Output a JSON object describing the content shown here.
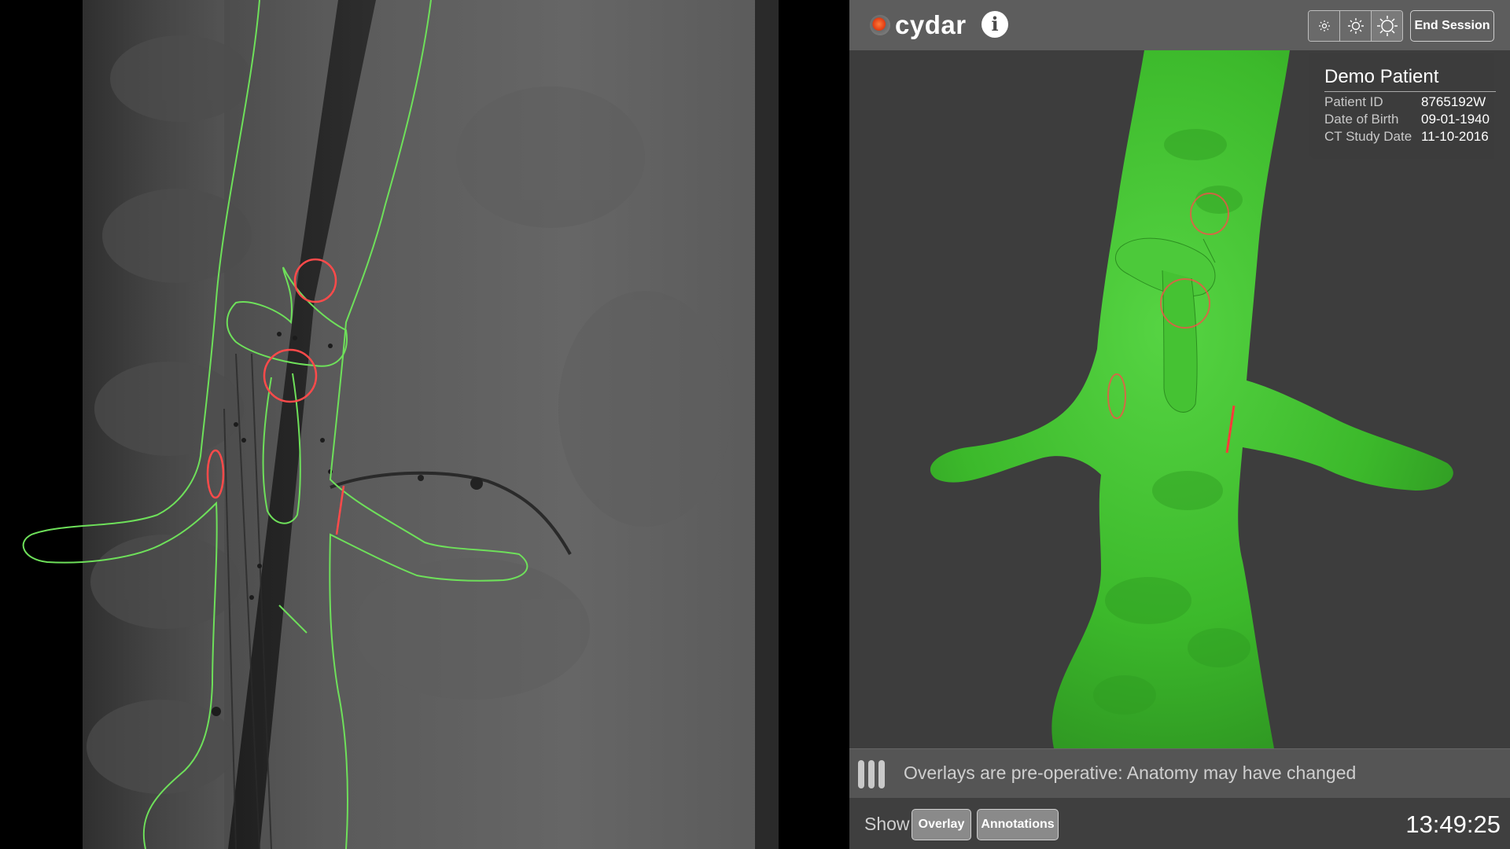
{
  "app": {
    "logo_text": "cydar",
    "info_label": "i",
    "brightness_icons": [
      "sun-small-icon",
      "sun-medium-icon",
      "sun-large-icon"
    ],
    "end_session_label": "End Session"
  },
  "patient": {
    "name": "Demo Patient",
    "fields": [
      {
        "label": "Patient ID",
        "value": "8765192W"
      },
      {
        "label": "Date of Birth",
        "value": "09-01-1940"
      },
      {
        "label": "CT Study Date",
        "value": "11-10-2016"
      }
    ]
  },
  "warning": {
    "text": "Overlays are pre-operative: Anatomy may have changed"
  },
  "controls": {
    "show_label": "Show",
    "overlay_label": "Overlay",
    "annotations_label": "Annotations",
    "time": "13:49:25"
  },
  "colors": {
    "overlay_green": "#6ee05a",
    "vessel_green": "#3fbf2e",
    "marker_red": "#ff4a4a",
    "header_gray": "#5d5d5d",
    "panel_gray": "#3d3d3d"
  }
}
